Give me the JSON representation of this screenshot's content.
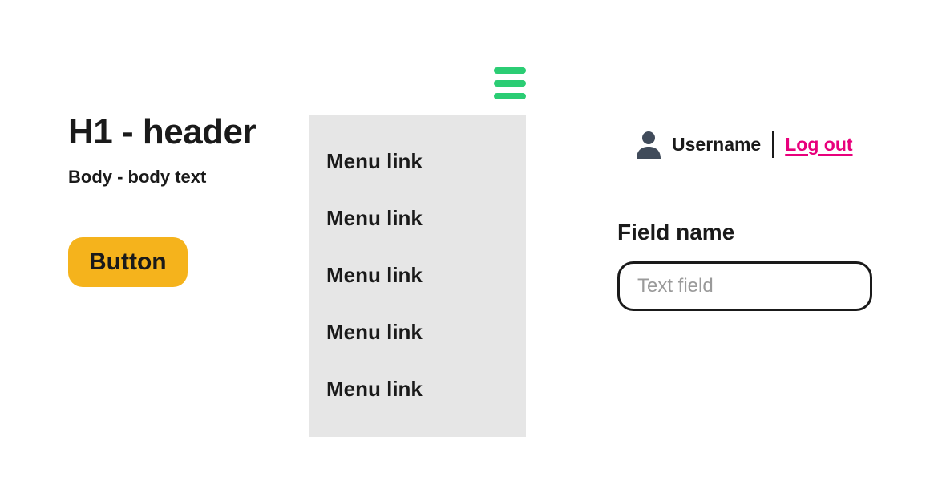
{
  "left": {
    "heading": "H1 - header",
    "body": "Body - body text",
    "button_label": "Button"
  },
  "menu": {
    "items": [
      "Menu link",
      "Menu link",
      "Menu link",
      "Menu link",
      "Menu link"
    ]
  },
  "user": {
    "name": "Username",
    "logout_label": "Log out"
  },
  "form": {
    "field_label": "Field name",
    "field_placeholder": "Text field"
  },
  "colors": {
    "accent_green": "#2bcd74",
    "accent_yellow": "#f5b31c",
    "accent_pink": "#e8007c"
  }
}
